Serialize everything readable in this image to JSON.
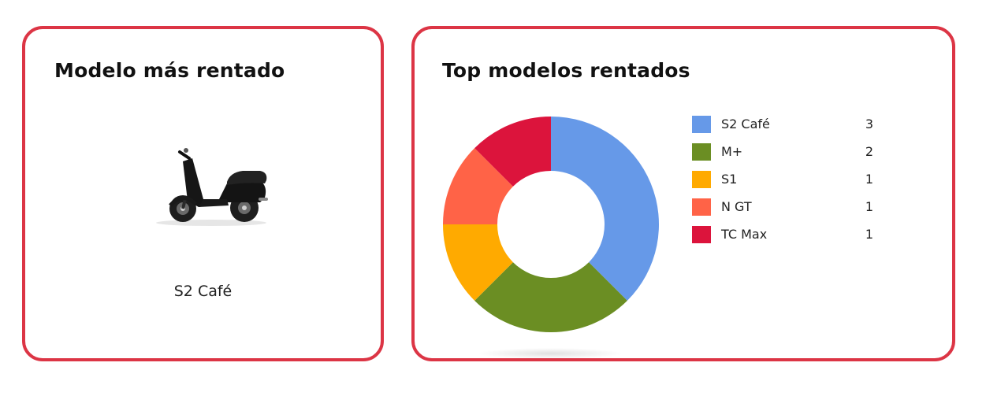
{
  "most_rented": {
    "title": "Modelo más rentado",
    "model_name": "S2 Café",
    "image_icon": "scooter-icon"
  },
  "top_models": {
    "title": "Top modelos rentados"
  },
  "chart_data": {
    "type": "pie",
    "variant": "donut",
    "title": "Top modelos rentados",
    "categories": [
      "S2 Café",
      "M+",
      "S1",
      "N GT",
      "TC Max"
    ],
    "values": [
      3,
      2,
      1,
      1,
      1
    ],
    "colors": [
      "#6699e8",
      "#6b8e23",
      "#ffaa00",
      "#ff6347",
      "#dc143c"
    ],
    "legend_position": "right",
    "grid": false
  },
  "colors": {
    "card_border": "#dc3545"
  }
}
